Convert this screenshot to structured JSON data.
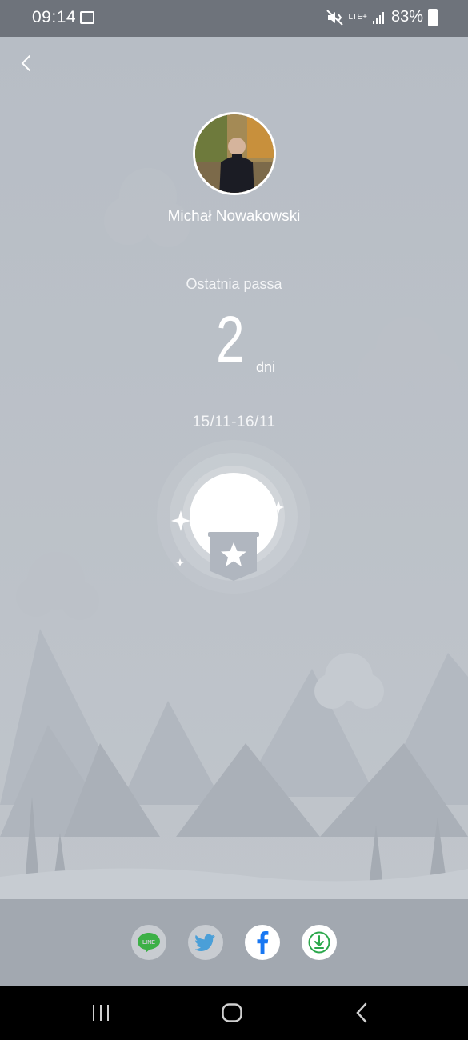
{
  "status_bar": {
    "time": "09:14",
    "network": "LTE+",
    "battery": "83%",
    "icons": [
      "image-icon",
      "mute-vibrate-icon",
      "signal-icon",
      "battery-icon"
    ]
  },
  "header": {
    "back_icon": "chevron-left-icon"
  },
  "profile": {
    "name": "Michał Nowakowski"
  },
  "streak": {
    "label": "Ostatnia passa",
    "value": "2",
    "unit": "dni",
    "date_range": "15/11-16/11",
    "badge_icon": "star-banner-icon"
  },
  "share": {
    "buttons": [
      {
        "name": "line",
        "icon": "line-icon",
        "label": "LINE",
        "color": "#3cb046"
      },
      {
        "name": "twitter",
        "icon": "twitter-icon",
        "color": "#4a9fd8"
      },
      {
        "name": "facebook",
        "icon": "facebook-icon",
        "color": "#1877f2"
      },
      {
        "name": "download",
        "icon": "download-icon",
        "color": "#2ca84c"
      }
    ]
  },
  "nav_bar": {
    "icons": [
      "recent-apps-icon",
      "home-icon",
      "back-icon"
    ]
  },
  "colors": {
    "background": "#b6bcc4",
    "share_bar": "#a2a8b0",
    "status_bar": "#6e737b"
  }
}
